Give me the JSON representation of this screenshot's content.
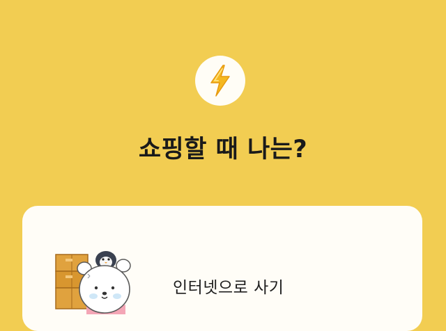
{
  "quiz": {
    "question_icon": "lightning-bolt-icon",
    "question": "쇼핑할 때 나는?",
    "options": [
      {
        "label": "인터넷으로 사기",
        "illustration": "bear-with-boxes-illustration"
      }
    ]
  },
  "colors": {
    "background": "#f2cd52",
    "card": "#fffdf7",
    "icon_circle": "#fffdf6",
    "bolt": "#f5b820",
    "text": "#1a1a1a"
  }
}
